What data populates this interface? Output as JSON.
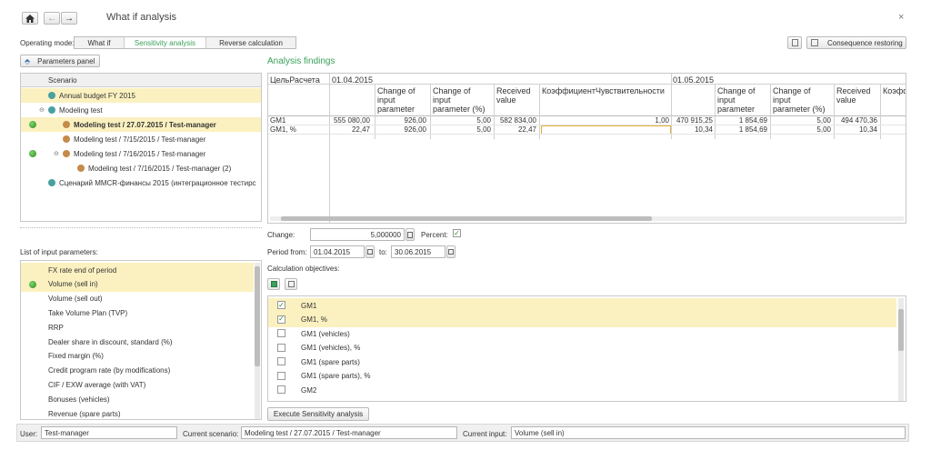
{
  "header": {
    "title": "What if analysis",
    "close_symbol": "×"
  },
  "mode": {
    "label": "Operating mode:",
    "tabs": [
      {
        "label": "What if",
        "active": false
      },
      {
        "label": "Sensitivity analysis",
        "active": true
      },
      {
        "label": "Reverse calculation",
        "active": false
      }
    ]
  },
  "toolbar_right": {
    "consequence_label": "Consequence restoring"
  },
  "parameters_panel": {
    "button_label": "Parameters panel"
  },
  "scenario": {
    "header": "Scenario",
    "items": [
      {
        "label": "Annual budget FY 2015",
        "indent": 1,
        "icon": "globe-icon",
        "dot": false,
        "highlight": true,
        "bold": false
      },
      {
        "label": "Modeling test",
        "indent": 1,
        "icon": "globe-icon",
        "dot": false,
        "highlight": false,
        "bold": false,
        "tree": "⊖"
      },
      {
        "label": "Modeling test / 27.07.2015 / Test-manager",
        "indent": 2,
        "icon": "user-icon",
        "dot": true,
        "highlight": true,
        "bold": true
      },
      {
        "label": "Modeling test / 7/15/2015 / Test-manager",
        "indent": 2,
        "icon": "user-icon",
        "dot": false,
        "highlight": false,
        "bold": false
      },
      {
        "label": "Modeling test / 7/16/2015 / Test-manager",
        "indent": 2,
        "icon": "users-icon",
        "dot": true,
        "highlight": false,
        "bold": false,
        "tree": "⊖"
      },
      {
        "label": "Modeling test / 7/16/2015 / Test-manager (2)",
        "indent": 3,
        "icon": "user-icon",
        "dot": false,
        "highlight": false,
        "bold": false
      },
      {
        "label": "Сценарий MMCR-финансы 2015 (интеграционное тестирс",
        "indent": 1,
        "icon": "globe-icon",
        "dot": false,
        "highlight": false,
        "bold": false
      }
    ]
  },
  "input_params": {
    "label": "List of input parameters:",
    "items": [
      {
        "label": "FX rate end of period",
        "highlight": true,
        "dot": false
      },
      {
        "label": "Volume (sell in)",
        "highlight": true,
        "dot": true
      },
      {
        "label": "Volume (sell out)",
        "highlight": false,
        "dot": false
      },
      {
        "label": "Take Volume Plan (TVP)",
        "highlight": false,
        "dot": false
      },
      {
        "label": "RRP",
        "highlight": false,
        "dot": false
      },
      {
        "label": "Dealer share in discount, standard (%)",
        "highlight": false,
        "dot": false
      },
      {
        "label": "Fixed margin (%)",
        "highlight": false,
        "dot": false
      },
      {
        "label": "Credit program rate (by modifications)",
        "highlight": false,
        "dot": false
      },
      {
        "label": "CIF / EXW average (with VAT)",
        "highlight": false,
        "dot": false
      },
      {
        "label": "Bonuses (vehicles)",
        "highlight": false,
        "dot": false
      },
      {
        "label": "Revenue (spare parts)",
        "highlight": false,
        "dot": false
      }
    ]
  },
  "findings": {
    "title": "Analysis findings",
    "target_header": "ЦельРасчета",
    "period1": "01.04.2015",
    "period2": "01.05.2015",
    "col_change": "Change of input parameter",
    "col_change_pct": "Change of input parameter (%)",
    "col_received": "Received value",
    "col_coef": "КоэффициентЧувствительности",
    "col_coef_cut": "Коэфф",
    "rows": [
      {
        "name": "GM1",
        "v1": "555 080,00",
        "c1": "926,00",
        "p1": "5,00",
        "r1": "582 834,00",
        "k1": "1,00",
        "v2": "470 915,25",
        "c2": "1 854,69",
        "p2": "5,00",
        "r2": "494 470,36"
      },
      {
        "name": "GM1, %",
        "v1": "22,47",
        "c1": "926,00",
        "p1": "5,00",
        "r1": "22,47",
        "k1": "",
        "v2": "10,34",
        "c2": "1 854,69",
        "p2": "5,00",
        "r2": "10,34"
      }
    ]
  },
  "controls": {
    "change_label": "Change:",
    "change_value": "5,000000",
    "percent_label": "Percent:",
    "percent_checked": true,
    "period_from_label": "Period from:",
    "period_from": "01.04.2015",
    "to_label": "to:",
    "period_to": "30.06.2015",
    "objectives_label": "Calculation objectives:"
  },
  "objectives": {
    "items": [
      {
        "label": "GM1",
        "checked": true
      },
      {
        "label": "GM1, %",
        "checked": true
      },
      {
        "label": "GM1 (vehicles)",
        "checked": false
      },
      {
        "label": "GM1 (vehicles), %",
        "checked": false
      },
      {
        "label": "GM1 (spare parts)",
        "checked": false
      },
      {
        "label": "GM1 (spare parts), %",
        "checked": false
      },
      {
        "label": "GM2",
        "checked": false
      }
    ]
  },
  "execute": {
    "label": "Execute Sensitivity analysis"
  },
  "status": {
    "user_label": "User:",
    "user_value": "Test-manager",
    "scenario_label": "Current scenario:",
    "scenario_value": "Modeling test / 27.07.2015 / Test-manager",
    "input_label": "Current input:",
    "input_value": "Volume (sell in)"
  },
  "colors": {
    "accent_green": "#3aa05a",
    "highlight": "#fbf1c0",
    "selected_border": "#e0b03a"
  }
}
